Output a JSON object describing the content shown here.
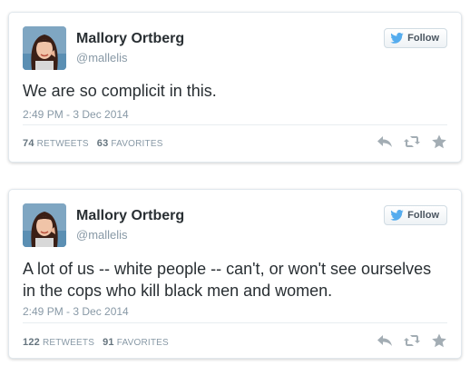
{
  "colors": {
    "name": "#292f33",
    "muted": "#8899a6",
    "icon": "#a3adb4",
    "twitter_blue": "#55acee"
  },
  "tweets": [
    {
      "author_name": "Mallory Ortberg",
      "handle": "@mallelis",
      "follow_label": "Follow",
      "text": "We are so complicit in this.",
      "timestamp": "2:49 PM - 3 Dec 2014",
      "retweets_count": "74",
      "retweets_label": "RETWEETS",
      "favorites_count": "63",
      "favorites_label": "FAVORITES",
      "icons": [
        "reply-icon",
        "retweet-icon",
        "favorite-icon"
      ]
    },
    {
      "author_name": "Mallory Ortberg",
      "handle": "@mallelis",
      "follow_label": "Follow",
      "text": "A lot of us -- white people -- can't, or won't see ourselves in the cops who kill black men and women.",
      "timestamp": "2:49 PM - 3 Dec 2014",
      "retweets_count": "122",
      "retweets_label": "RETWEETS",
      "favorites_count": "91",
      "favorites_label": "FAVORITES",
      "icons": [
        "reply-icon",
        "retweet-icon",
        "favorite-icon"
      ]
    }
  ]
}
